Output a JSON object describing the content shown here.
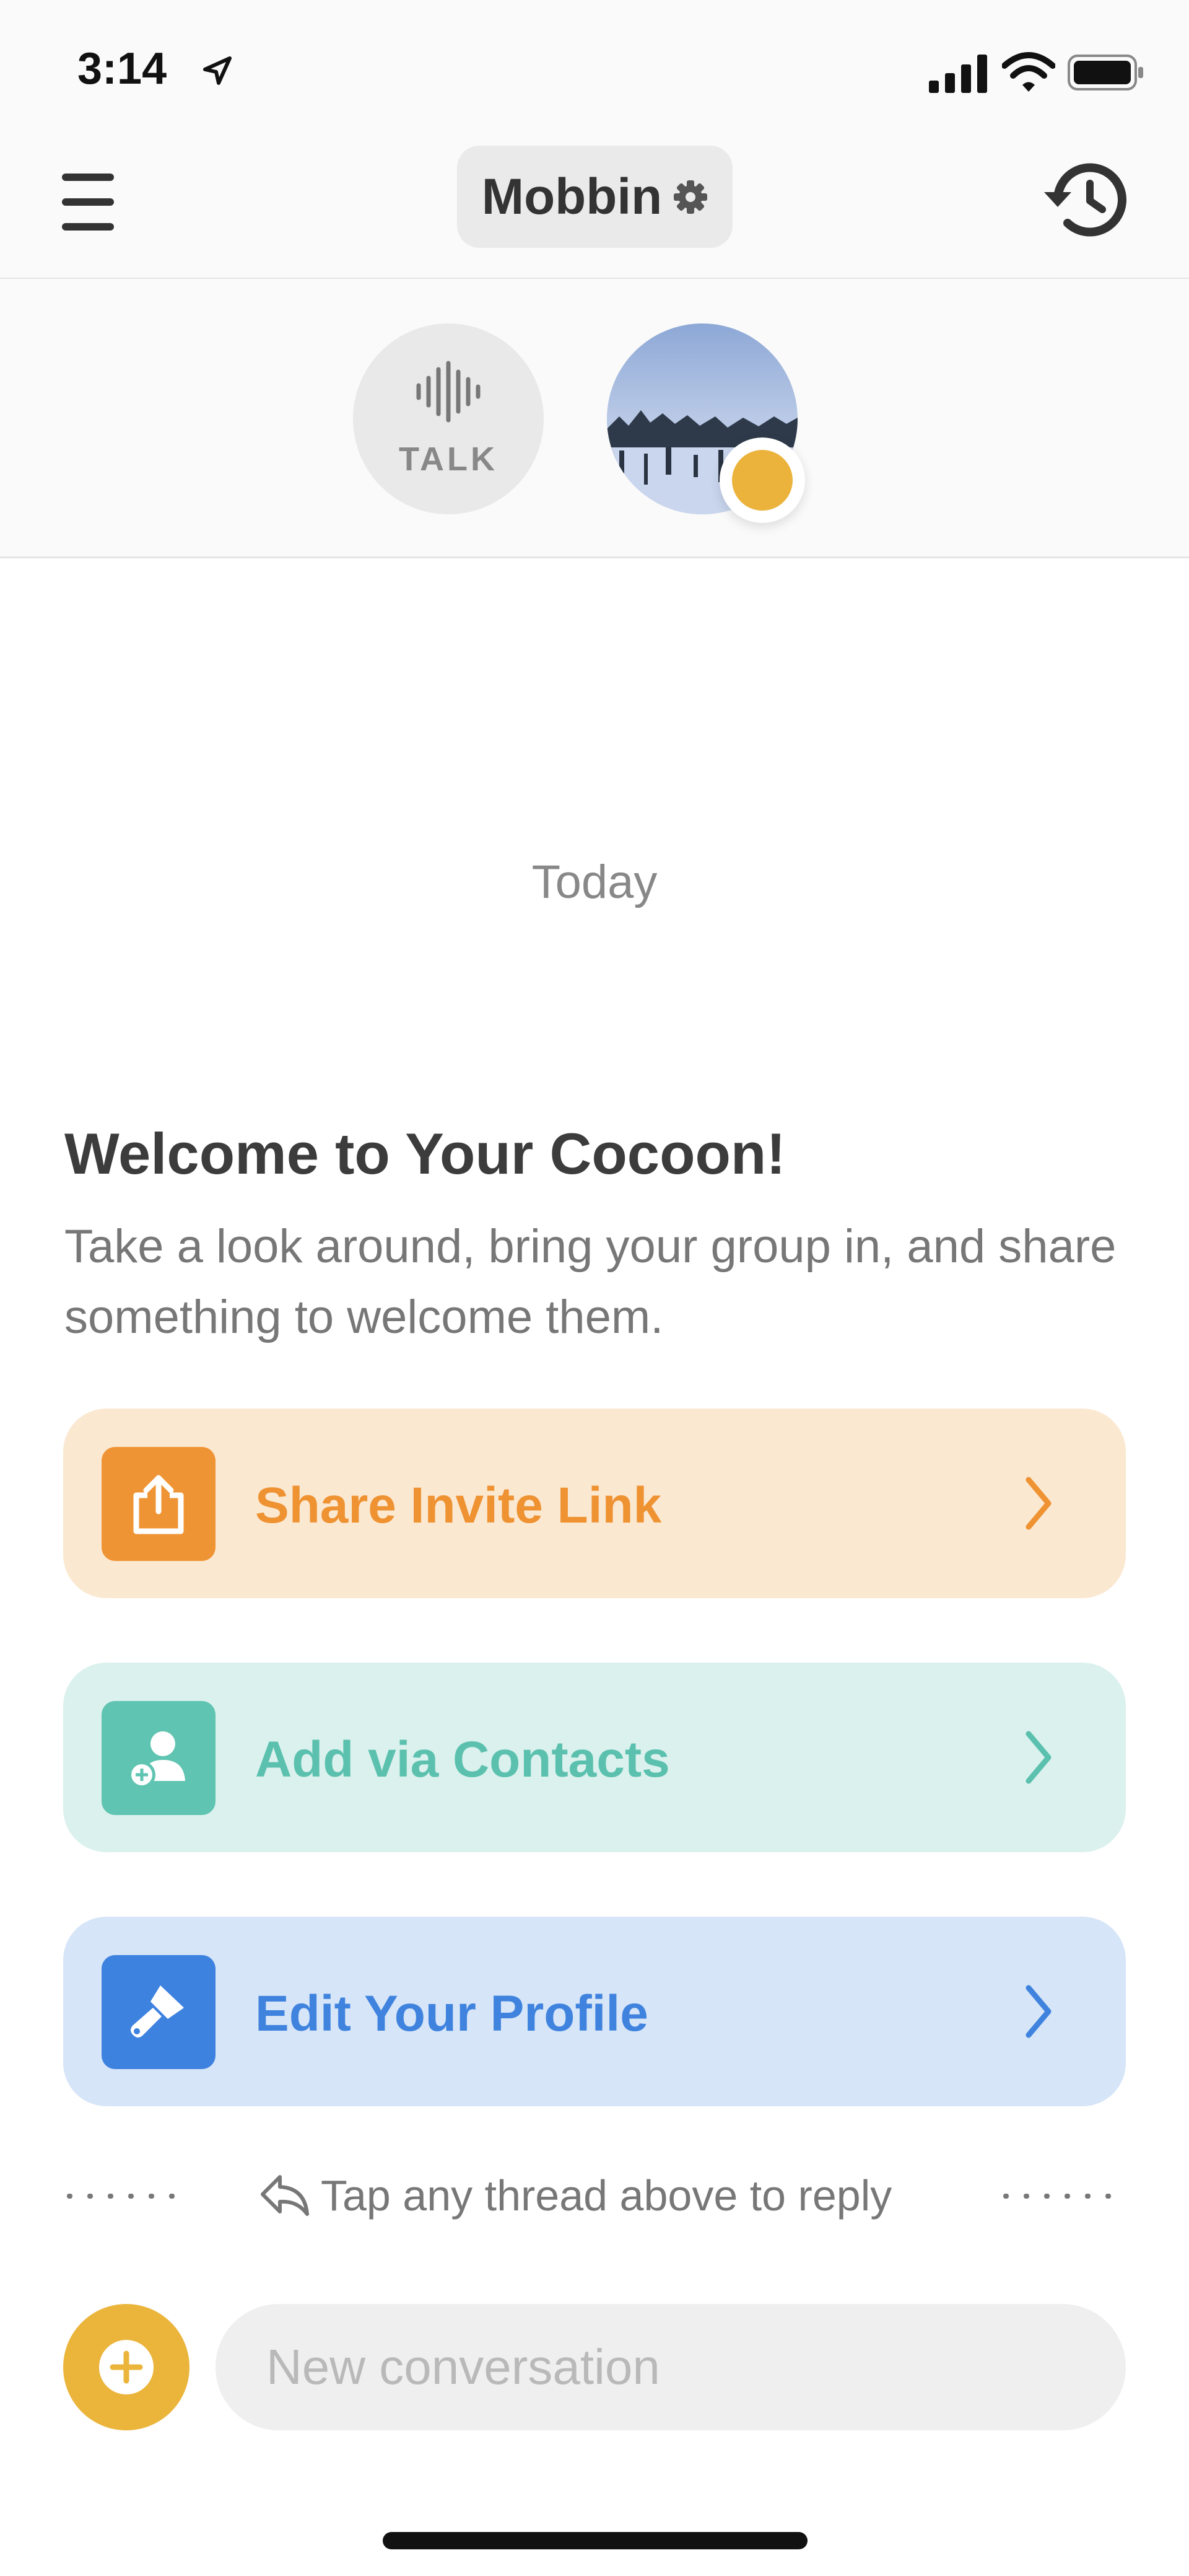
{
  "status_bar": {
    "time": "3:14"
  },
  "header": {
    "group_name": "Mobbin"
  },
  "members": {
    "talk_label": "TALK"
  },
  "feed": {
    "date_separator": "Today",
    "welcome_title": "Welcome to Your Cocoon!",
    "welcome_body": "Take a look around, bring your group in, and share something to welcome them."
  },
  "actions": [
    {
      "label": "Share Invite Link",
      "icon": "share-icon",
      "color": "#ef9434"
    },
    {
      "label": "Add via Contacts",
      "icon": "add-contact-icon",
      "color": "#5fc4b1"
    },
    {
      "label": "Edit Your Profile",
      "icon": "paint-brush-icon",
      "color": "#3e82e0"
    }
  ],
  "hint": {
    "text": "Tap any thread above to reply"
  },
  "composer": {
    "placeholder": "New conversation"
  },
  "colors": {
    "accent_yellow": "#ebb53c",
    "background": "#fafafa"
  }
}
